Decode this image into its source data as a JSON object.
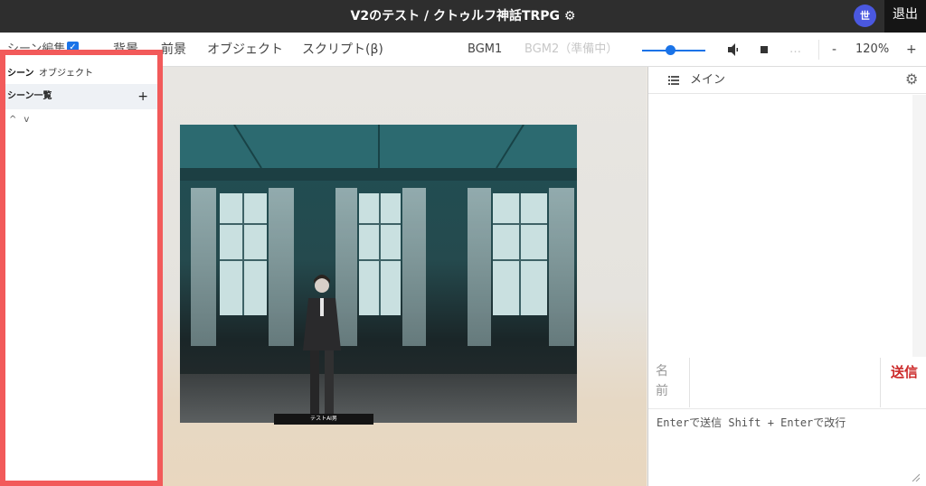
{
  "titlebar": {
    "title": "V2のテスト / クトゥルフ神話TRPG ⚙",
    "avatar_text": "世",
    "exit_label": "退出"
  },
  "toolbar": {
    "scene_edit_label": "シーン編集",
    "scene_edit_checked": true,
    "background_label": "背景",
    "foreground_label": "前景",
    "object_label": "オブジェクト",
    "script_label": "スクリプト(β)",
    "bgm1_label": "BGM1",
    "bgm2_label": "BGM2（準備中）",
    "volume_fraction": 0.45,
    "extra_label": "…",
    "zoom_out": "-",
    "zoom_value": "120%",
    "zoom_in": "+"
  },
  "left_panel": {
    "tabs": [
      {
        "label": "シーン",
        "active": true
      },
      {
        "label": "オブジェクト",
        "active": false
      }
    ],
    "list_header": "シーン一覧",
    "add_symbol": "+",
    "move_up": "^",
    "move_down": "v"
  },
  "stage": {
    "character_label": "テストAI男"
  },
  "chat": {
    "tab_label": "メイン",
    "name_label": "名前",
    "send_label": "送信",
    "input_placeholder": "Enterで送信 Shift + Enterで改行"
  },
  "colors": {
    "accent": "#1a73e8",
    "highlight_border": "#f25a5a",
    "send": "#cc2a2a",
    "avatar": "#4a58e0"
  }
}
